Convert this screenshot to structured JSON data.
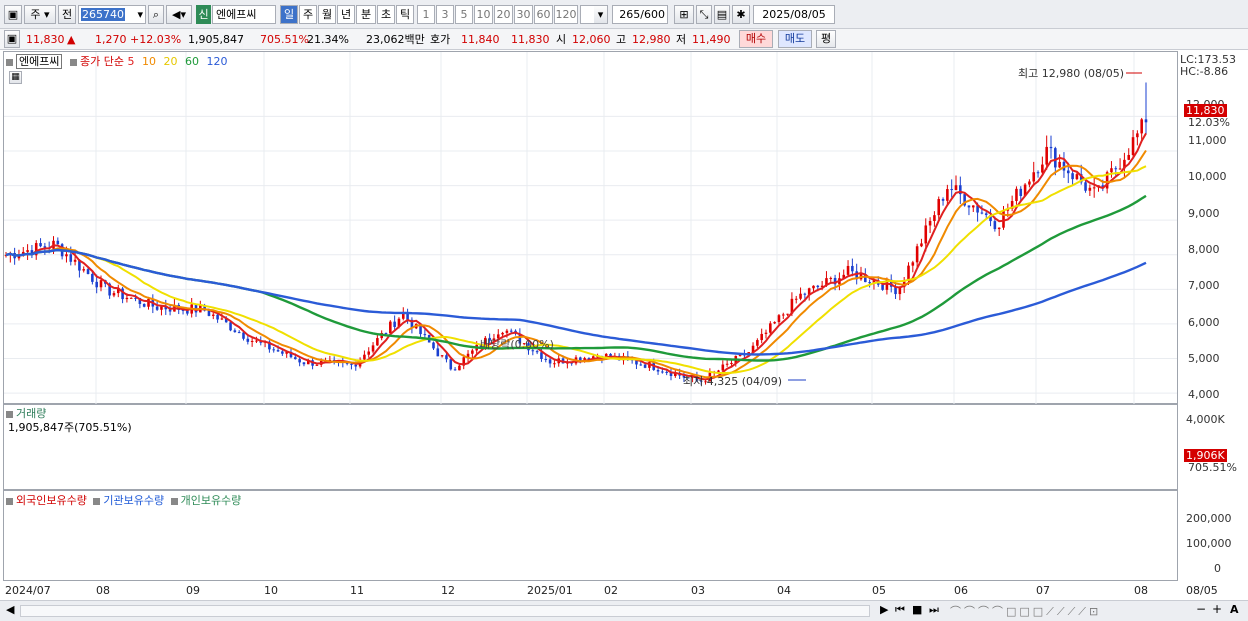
{
  "toolbar": {
    "mode_main": "주",
    "prev": "전",
    "code": "265740",
    "name_prefix": "신",
    "name": "엔에프씨",
    "timeframes": [
      "일",
      "주",
      "월",
      "년",
      "분",
      "초",
      "틱"
    ],
    "minutes": [
      "1",
      "3",
      "5",
      "10",
      "20",
      "30",
      "60",
      "120"
    ],
    "count": "265",
    "count_total": "/600",
    "date": "2025/08/05"
  },
  "quote": {
    "price": "11,830",
    "arrow": "▲",
    "change": "1,270",
    "change_pct": "+12.03%",
    "volume": "1,905,847",
    "volume_ratio": "705.51%",
    "turnover": "21.34%",
    "amount": "23,062백만",
    "bid_label": "호가",
    "ask": "11,840",
    "bid": "11,830",
    "open_label": "시",
    "open": "12,060",
    "high_label": "고",
    "high": "12,980",
    "low_label": "저",
    "low": "11,490",
    "buy": "매수",
    "sell": "매도",
    "eval": "평"
  },
  "price_panel": {
    "name": "엔에프씨",
    "series_label": "종가 단순",
    "ma_labels": [
      "5",
      "10",
      "20",
      "60",
      "120"
    ],
    "ma_colors": [
      "#e02020",
      "#f08a00",
      "#f0e000",
      "#1f9a3a",
      "#2b5bd7"
    ],
    "lc": "LC:173.53",
    "hc": "HC:-8.86",
    "high_note": "최고 12,980 (08/05)",
    "low_note": "최저 4,325 (04/09)",
    "ex_note": "배당락(0.00%)",
    "y_ticks": [
      "12,000",
      "11,000",
      "10,000",
      "9,000",
      "8,000",
      "7,000",
      "6,000",
      "5,000",
      "4,000"
    ],
    "last_price": "11,830",
    "last_pct": "12.03%"
  },
  "volume_panel": {
    "title": "거래량",
    "value": "1,905,847주(705.51%)",
    "y_ticks": [
      "4,000K",
      "0"
    ],
    "last": "1,906K",
    "last_pct": "705.51%"
  },
  "holding_panel": {
    "legend": [
      "외국인보유수량",
      "기관보유수량",
      "개인보유수량"
    ],
    "colors": [
      "#d00000",
      "#1f5ad7",
      "#2e8b57"
    ],
    "y_ticks": [
      "200,000",
      "100,000",
      "0"
    ]
  },
  "x_axis": [
    "2024/07",
    "08",
    "09",
    "10",
    "11",
    "12",
    "2025/01",
    "02",
    "03",
    "04",
    "05",
    "06",
    "07",
    "08",
    "08/05"
  ],
  "chart_data": {
    "type": "candlestick",
    "title": "엔에프씨",
    "ylim": [
      3800,
      13400
    ],
    "high": 12980,
    "low": 4325,
    "close": 11830,
    "anchors_close": [
      {
        "d": "2024/07",
        "v": 8000
      },
      {
        "d": "08",
        "v": 8300
      },
      {
        "d": "08m",
        "v": 7000
      },
      {
        "d": "09",
        "v": 6500
      },
      {
        "d": "10",
        "v": 6400
      },
      {
        "d": "11",
        "v": 5500
      },
      {
        "d": "11m",
        "v": 4900
      },
      {
        "d": "12",
        "v": 4800
      },
      {
        "d": "12m",
        "v": 6300
      },
      {
        "d": "2025/01",
        "v": 4700
      },
      {
        "d": "01m",
        "v": 5900
      },
      {
        "d": "02",
        "v": 4900
      },
      {
        "d": "03",
        "v": 5100
      },
      {
        "d": "04",
        "v": 4800
      },
      {
        "d": "04/09",
        "v": 4325
      },
      {
        "d": "05",
        "v": 5200
      },
      {
        "d": "05m",
        "v": 6800
      },
      {
        "d": "06",
        "v": 7500
      },
      {
        "d": "06m",
        "v": 7000
      },
      {
        "d": "07",
        "v": 10000
      },
      {
        "d": "07m",
        "v": 8900
      },
      {
        "d": "07e",
        "v": 11000
      },
      {
        "d": "08",
        "v": 9700
      },
      {
        "d": "08/05",
        "v": 11830
      }
    ]
  }
}
